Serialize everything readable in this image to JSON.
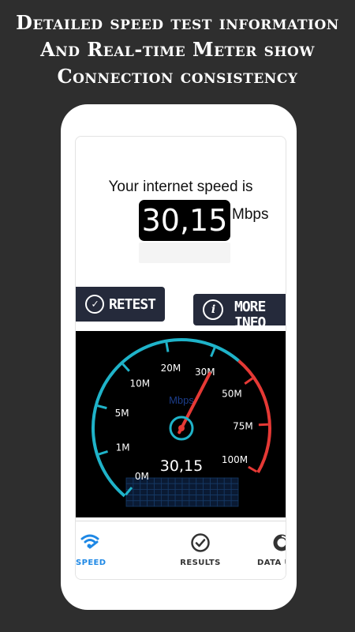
{
  "headline": {
    "line1": "Detailed speed test information",
    "line2": "And Real-time Meter show",
    "line3": "Connection consistency"
  },
  "result": {
    "label": "Your internet speed is",
    "value": "30,15",
    "unit": "Mbps"
  },
  "buttons": {
    "retest": "RETEST",
    "more_info_line1": "MORE",
    "more_info_line2": "INFO"
  },
  "gauge": {
    "ticks": [
      "0M",
      "1M",
      "5M",
      "10M",
      "20M",
      "30M",
      "50M",
      "75M",
      "100M"
    ],
    "unit": "Mbps",
    "reading": "30,15",
    "needle_tick_position": 5.15,
    "colors": {
      "arc": "#1fb3c9",
      "redzone": "#e53935",
      "needle": "#e53935",
      "grid": "#163a66"
    }
  },
  "nav": {
    "items": [
      {
        "label": "SPEED",
        "icon": "wifi-icon",
        "active": true
      },
      {
        "label": "RESULTS",
        "icon": "check-circle-icon",
        "active": false
      },
      {
        "label": "DATA US",
        "icon": "donut-chart-icon",
        "active": false
      }
    ],
    "active_color": "#1e88e5"
  }
}
